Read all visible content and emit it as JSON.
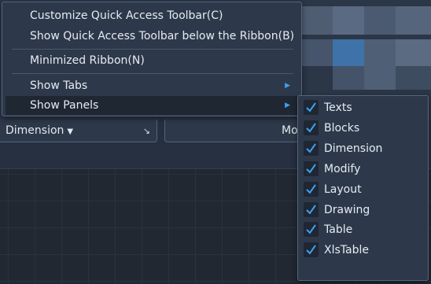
{
  "menu": {
    "items": [
      {
        "label": "Customize Quick Access Toolbar(C)"
      },
      {
        "label": "Show Quick Access Toolbar below the Ribbon(B)"
      },
      {
        "label": "Minimized Ribbon(N)"
      },
      {
        "label": "Show Tabs"
      },
      {
        "label": "Show Panels"
      }
    ]
  },
  "submenu": {
    "items": [
      {
        "label": "Texts",
        "checked": true
      },
      {
        "label": "Blocks",
        "checked": true
      },
      {
        "label": "Dimension",
        "checked": true
      },
      {
        "label": "Modify",
        "checked": true
      },
      {
        "label": "Layout",
        "checked": true
      },
      {
        "label": "Drawing",
        "checked": true
      },
      {
        "label": "Table",
        "checked": true
      },
      {
        "label": "XlsTable",
        "checked": true
      }
    ]
  },
  "ribbon": {
    "dimension_caption": "Dimension",
    "dropdown_glyph": "▼",
    "launcher_glyph": "↘",
    "modify_caption": "Mo"
  },
  "colors": {
    "accent": "#3fa0f0",
    "menu_bg": "#2d394a",
    "selected_bg": "#1f2733",
    "text": "#e6ebf2"
  },
  "icons": {
    "submenu_arrow": "▶",
    "check": "check-icon"
  }
}
